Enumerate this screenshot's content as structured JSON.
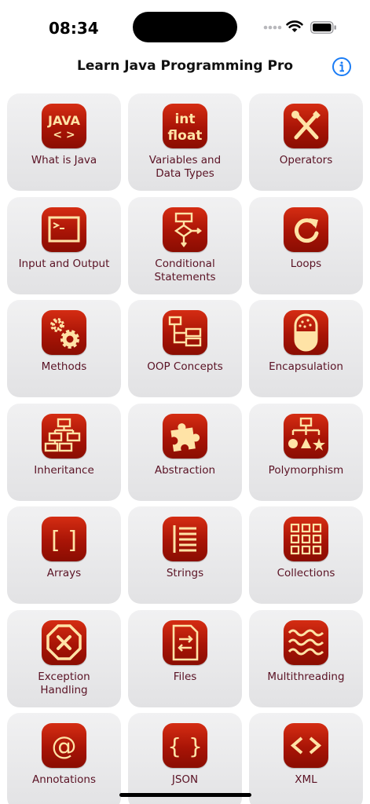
{
  "status": {
    "time": "08:34",
    "icons": [
      "signal-dots-icon",
      "wifi-icon",
      "battery-icon"
    ]
  },
  "nav": {
    "title": "Learn Java Programming Pro",
    "info_icon": "info-circle-icon"
  },
  "colors": {
    "tile_icon_red": "#b81a08",
    "icon_glyph": "#ffe3a6",
    "label_text": "#5a1224",
    "tile_bg": "#e9e9eb",
    "accent_blue": "#1a7cf5"
  },
  "topics": [
    {
      "label": "What is Java",
      "icon": "java-text-icon"
    },
    {
      "label": "Variables and Data Types",
      "icon": "int-float-icon"
    },
    {
      "label": "Operators",
      "icon": "tools-icon"
    },
    {
      "label": "Input and Output",
      "icon": "terminal-icon"
    },
    {
      "label": "Conditional Statements",
      "icon": "flowchart-icon"
    },
    {
      "label": "Loops",
      "icon": "loop-arrow-icon"
    },
    {
      "label": "Methods",
      "icon": "gears-icon"
    },
    {
      "label": "OOP Concepts",
      "icon": "class-diagram-icon"
    },
    {
      "label": "Encapsulation",
      "icon": "capsule-icon"
    },
    {
      "label": "Inheritance",
      "icon": "hierarchy-icon"
    },
    {
      "label": "Abstraction",
      "icon": "puzzle-icon"
    },
    {
      "label": "Polymorphism",
      "icon": "shapes-tree-icon"
    },
    {
      "label": "Arrays",
      "icon": "brackets-icon"
    },
    {
      "label": "Strings",
      "icon": "text-lines-icon"
    },
    {
      "label": "Collections",
      "icon": "grid-icon"
    },
    {
      "label": "Exception Handling",
      "icon": "octagon-x-icon"
    },
    {
      "label": "Files",
      "icon": "file-arrows-icon"
    },
    {
      "label": "Multithreading",
      "icon": "waves-icon"
    },
    {
      "label": "Annotations",
      "icon": "at-sign-icon"
    },
    {
      "label": "JSON",
      "icon": "braces-icon"
    },
    {
      "label": "XML",
      "icon": "angle-brackets-icon"
    }
  ]
}
